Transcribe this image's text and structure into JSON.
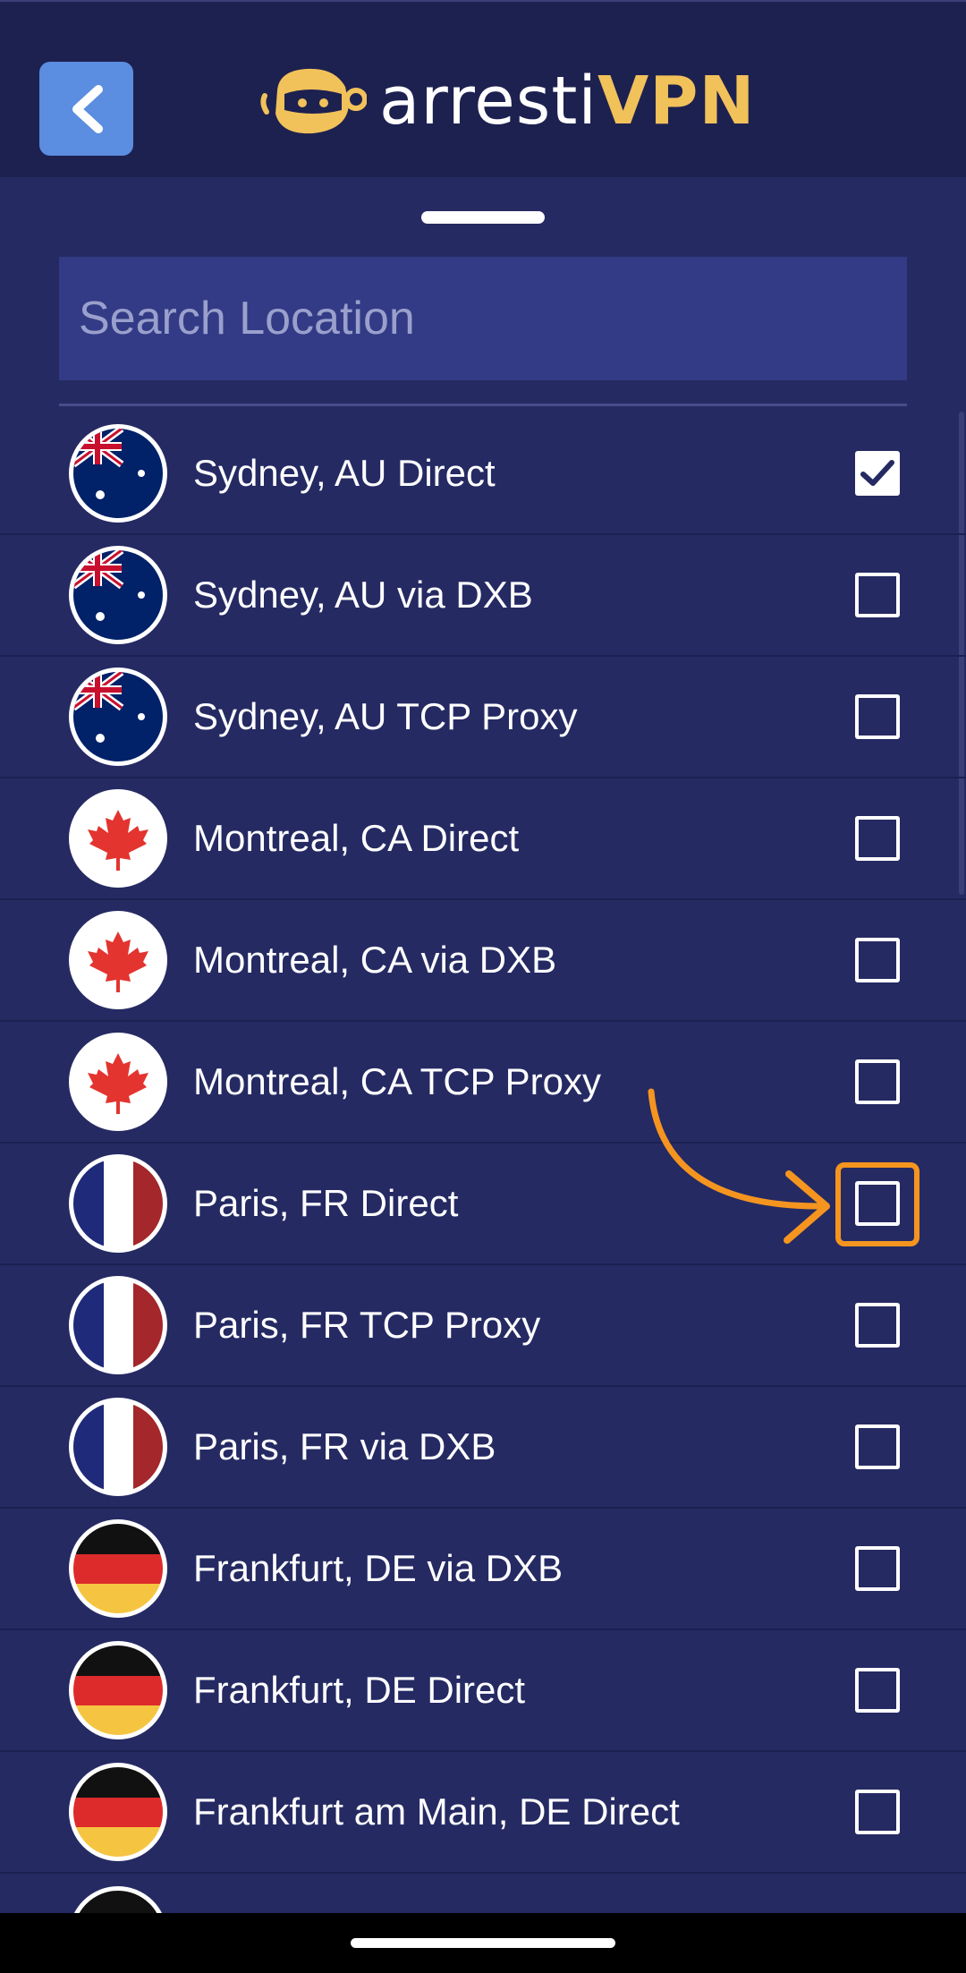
{
  "header": {
    "logo_text_white": "arresti",
    "logo_text_gold": "VPN"
  },
  "search": {
    "placeholder": "Search Location"
  },
  "locations": [
    {
      "label": "Sydney, AU Direct",
      "flag": "au-flag-icon",
      "checked": true
    },
    {
      "label": "Sydney, AU via DXB",
      "flag": "au-flag-icon",
      "checked": false
    },
    {
      "label": "Sydney, AU TCP Proxy",
      "flag": "au-flag-icon",
      "checked": false
    },
    {
      "label": "Montreal, CA Direct",
      "flag": "ca-flag-icon",
      "checked": false
    },
    {
      "label": "Montreal, CA via DXB",
      "flag": "ca-flag-icon",
      "checked": false
    },
    {
      "label": "Montreal, CA TCP Proxy",
      "flag": "ca-flag-icon",
      "checked": false
    },
    {
      "label": "Paris, FR Direct",
      "flag": "fr-flag-icon",
      "checked": false
    },
    {
      "label": "Paris, FR TCP Proxy",
      "flag": "fr-flag-icon",
      "checked": false
    },
    {
      "label": "Paris, FR via DXB",
      "flag": "fr-flag-icon",
      "checked": false
    },
    {
      "label": "Frankfurt, DE via DXB",
      "flag": "de-flag-icon",
      "checked": false
    },
    {
      "label": "Frankfurt, DE Direct",
      "flag": "de-flag-icon",
      "checked": false
    },
    {
      "label": "Frankfurt am Main, DE Direct",
      "flag": "de-flag-icon",
      "checked": false
    }
  ],
  "colors": {
    "background": "#252a63",
    "header": "#1d2150",
    "back_button": "#5b8de0",
    "accent_gold": "#f1c15a",
    "annotation_orange": "#f5951f"
  }
}
